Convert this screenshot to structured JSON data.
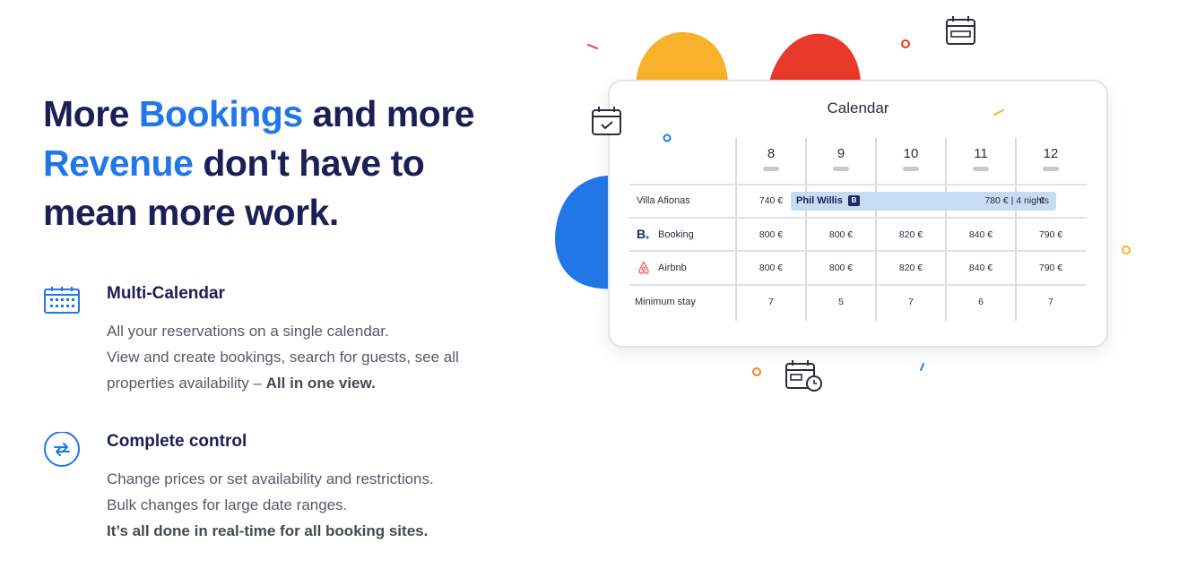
{
  "headline": {
    "part1": "More ",
    "accent1": "Bookings",
    "part2": " and more",
    "accent2": "Revenue",
    "part3": " don't have to",
    "part4": "mean more work."
  },
  "features": [
    {
      "icon": "calendar-grid-icon",
      "title": "Multi-Calendar",
      "lines": [
        "All your reservations on a single calendar.",
        "View and create bookings, search for guests, see all"
      ],
      "line3_prefix": "properties availability – ",
      "line3_bold": "All in one view."
    },
    {
      "icon": "sync-arrows-icon",
      "title": "Complete control",
      "lines": [
        "Change prices or set availability and restrictions.",
        "Bulk changes for large date ranges."
      ],
      "line3_bold": "It’s all done in real-time for all booking sites."
    }
  ],
  "calendar": {
    "title": "Calendar",
    "days": [
      "8",
      "9",
      "10",
      "11",
      "12"
    ],
    "rows": [
      {
        "label": "Villa Afionas",
        "values": [
          "740 €",
          "",
          "",
          "",
          "€"
        ]
      },
      {
        "label": "Booking",
        "icon": "booking-logo-icon",
        "values": [
          "800 €",
          "800 €",
          "820 €",
          "840 €",
          "790 €"
        ]
      },
      {
        "label": "Airbnb",
        "icon": "airbnb-logo-icon",
        "values": [
          "800 €",
          "800 €",
          "820 €",
          "840 €",
          "790 €"
        ]
      },
      {
        "label": "Minimum stay",
        "values": [
          "7",
          "5",
          "7",
          "6",
          "7"
        ]
      }
    ],
    "booking": {
      "guest": "Phil Willis",
      "badge": "B",
      "price": "780 €",
      "separator": "|",
      "nights": "4 nights"
    }
  },
  "colors": {
    "accent": "#2277e8",
    "navy": "#1b1f55",
    "blob_yellow": "#f9b02a",
    "blob_red": "#e8392b",
    "blob_blue": "#2277e8",
    "bar": "#c5dcf3"
  }
}
